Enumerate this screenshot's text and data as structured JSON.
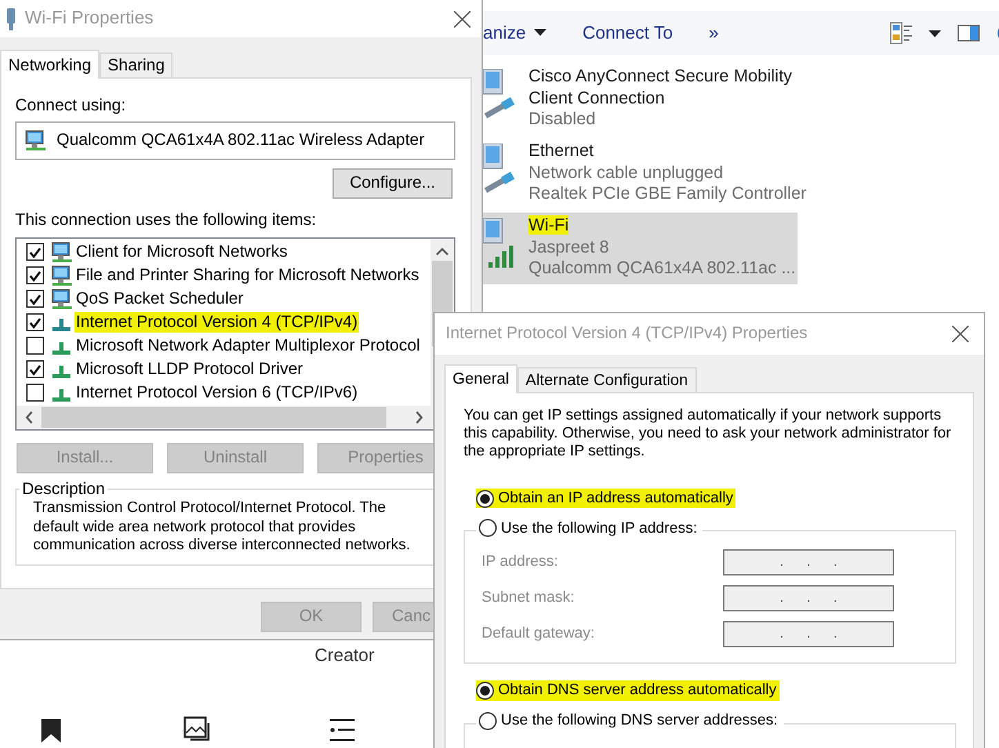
{
  "explorer": {
    "toolbar": [
      {
        "label": "anize",
        "kind": "menu"
      },
      {
        "label": "Connect To",
        "kind": "command"
      },
      {
        "label": "»",
        "kind": "command"
      }
    ],
    "connections": [
      {
        "name": "Cisco AnyConnect Secure Mobility Client Connection",
        "status": "Disabled",
        "kind": "wired",
        "selected": false,
        "highlighted": false
      },
      {
        "name": "Ethernet",
        "status": "Network cable unplugged",
        "device": "Realtek PCIe GBE Family Controller",
        "kind": "wired",
        "selected": false,
        "highlighted": false
      },
      {
        "name": "Wi-Fi",
        "status": "Jaspreet 8",
        "device": "Qualcomm QCA61x4A 802.11ac ...",
        "kind": "wireless",
        "selected": true,
        "highlighted": true
      }
    ]
  },
  "background": {
    "caption": "Creator"
  },
  "wifi_properties": {
    "title": "Wi-Fi Properties",
    "tabs": [
      {
        "label": "Networking",
        "selected": true
      },
      {
        "label": "Sharing",
        "selected": false
      }
    ],
    "connect_using_label": "Connect using:",
    "adapter": "Qualcomm QCA61x4A 802.11ac Wireless Adapter",
    "configure_button": "Configure...",
    "items_label": "This connection uses the following items:",
    "items": [
      {
        "label": "Client for Microsoft Networks",
        "kind": "client",
        "checked": true,
        "highlighted": false
      },
      {
        "label": "File and Printer Sharing for Microsoft Networks",
        "kind": "service",
        "checked": true,
        "highlighted": false
      },
      {
        "label": "QoS Packet Scheduler",
        "kind": "service",
        "checked": true,
        "highlighted": false
      },
      {
        "label": "Internet Protocol Version 4 (TCP/IPv4)",
        "kind": "protocol",
        "checked": true,
        "highlighted": true
      },
      {
        "label": "Microsoft Network Adapter Multiplexor Protocol",
        "kind": "protocol",
        "checked": false,
        "highlighted": false
      },
      {
        "label": "Microsoft LLDP Protocol Driver",
        "kind": "protocol",
        "checked": true,
        "highlighted": false
      },
      {
        "label": "Internet Protocol Version 6 (TCP/IPv6)",
        "kind": "protocol",
        "checked": false,
        "highlighted": false
      }
    ],
    "item_buttons": [
      {
        "label": "Install...",
        "disabled": true
      },
      {
        "label": "Uninstall",
        "disabled": true
      },
      {
        "label": "Properties",
        "disabled": true
      }
    ],
    "description": {
      "legend": "Description",
      "text": "Transmission Control Protocol/Internet Protocol. The default wide area network protocol that provides communication across diverse interconnected networks."
    },
    "footer_buttons": [
      {
        "label": "OK",
        "disabled": true
      },
      {
        "label": "Canc",
        "disabled": true
      }
    ]
  },
  "ipv4_properties": {
    "title": "Internet Protocol Version 4 (TCP/IPv4) Properties",
    "tabs": [
      {
        "label": "General",
        "selected": true
      },
      {
        "label": "Alternate Configuration",
        "selected": false
      }
    ],
    "intro": "You can get IP settings assigned automatically if your network supports this capability. Otherwise, you need to ask your network administrator for the appropriate IP settings.",
    "ip_auto": {
      "label": "Obtain an IP address automatically",
      "selected": true,
      "highlighted": true
    },
    "ip_manual": {
      "label": "Use the following IP address:",
      "selected": false,
      "highlighted": false
    },
    "ip_fields": [
      {
        "label": "IP address:",
        "value": ".      .      ."
      },
      {
        "label": "Subnet mask:",
        "value": ".      .      ."
      },
      {
        "label": "Default gateway:",
        "value": ".      .      ."
      }
    ],
    "dns_auto": {
      "label": "Obtain DNS server address automatically",
      "selected": true,
      "highlighted": true
    },
    "dns_manual": {
      "label": "Use the following DNS server addresses:",
      "selected": false,
      "highlighted": false
    }
  }
}
